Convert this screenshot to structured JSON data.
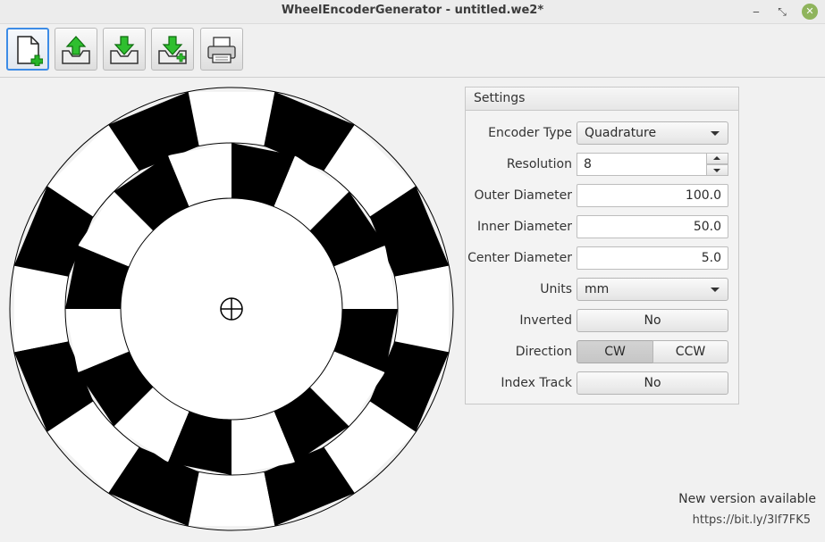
{
  "window": {
    "title": "WheelEncoderGenerator - untitled.we2*",
    "controls": {
      "minimize": "‒",
      "restore": "⤡",
      "close": "✕"
    }
  },
  "toolbar": {
    "buttons": [
      {
        "name": "new-button",
        "icon": "new-document-icon"
      },
      {
        "name": "open-button",
        "icon": "open-icon"
      },
      {
        "name": "save-button",
        "icon": "save-icon"
      },
      {
        "name": "save-as-button",
        "icon": "save-as-icon"
      },
      {
        "name": "print-button",
        "icon": "printer-icon"
      }
    ]
  },
  "settings": {
    "title": "Settings",
    "encoder_type_label": "Encoder Type",
    "encoder_type_value": "Quadrature",
    "resolution_label": "Resolution",
    "resolution_value": "8",
    "outer_diameter_label": "Outer Diameter",
    "outer_diameter_value": "100.0",
    "inner_diameter_label": "Inner Diameter",
    "inner_diameter_value": "50.0",
    "center_diameter_label": "Center Diameter",
    "center_diameter_value": "5.0",
    "units_label": "Units",
    "units_value": "mm",
    "inverted_label": "Inverted",
    "inverted_value": "No",
    "direction_label": "Direction",
    "direction_cw": "CW",
    "direction_ccw": "CCW",
    "direction_selected": "CW",
    "index_track_label": "Index Track",
    "index_track_value": "No"
  },
  "status": {
    "new_version": "New version available",
    "link": "https://bit.ly/3lf7FK5"
  },
  "colors": {
    "black": "#000000",
    "white": "#ffffff",
    "accent": "#3d8ce6",
    "green_icon": "#2fbf2f"
  }
}
